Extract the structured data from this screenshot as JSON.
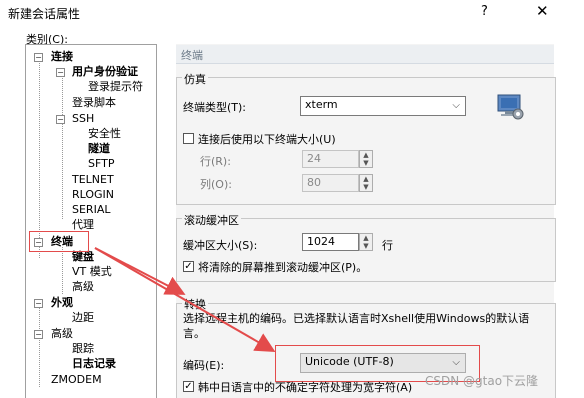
{
  "window": {
    "title": "新建会话属性",
    "help_glyph": "?",
    "close_glyph": "✕"
  },
  "category_label": "类别(C):",
  "tree": {
    "connection": "连接",
    "user_auth": "用户身份验证",
    "login_prompt": "登录提示符",
    "login_script": "登录脚本",
    "ssh": "SSH",
    "security": "安全性",
    "tunnel": "隧道",
    "sftp": "SFTP",
    "telnet": "TELNET",
    "rlogin": "RLOGIN",
    "serial": "SERIAL",
    "proxy": "代理",
    "terminal": "终端",
    "keyboard": "键盘",
    "vt_mode": "VT 模式",
    "advanced": "高级",
    "appearance": "外观",
    "margin": "边距",
    "advanced2": "高级",
    "trace": "跟踪",
    "logging": "日志记录",
    "zmodem": "ZMODEM"
  },
  "section_title": "终端",
  "emulation": {
    "group": "仿真",
    "terminal_type_label": "终端类型(T):",
    "terminal_type_value": "xterm",
    "use_size_label": "连接后使用以下终端大小(U)",
    "rows_label": "行(R):",
    "rows_value": "24",
    "cols_label": "列(O):",
    "cols_value": "80"
  },
  "scroll": {
    "group": "滚动缓冲区",
    "buffer_label": "缓冲区大小(S):",
    "buffer_value": "1024",
    "unit": "行",
    "push_label": "将清除的屏幕推到滚动缓冲区(P)。"
  },
  "convert": {
    "group": "转换",
    "desc": "选择远程主机的编码。已选择默认语言时Xshell使用Windows的默认语言。",
    "encoding_label": "编码(E):",
    "encoding_value": "Unicode (UTF-8)",
    "cjk_label": "韩中日语言中的不确定字符处理为宽字符(A)"
  },
  "watermark": "CSDN @gtao下云隆",
  "colors": {
    "annotation_red": "#e34b4b",
    "section_text": "#6c7a88"
  }
}
